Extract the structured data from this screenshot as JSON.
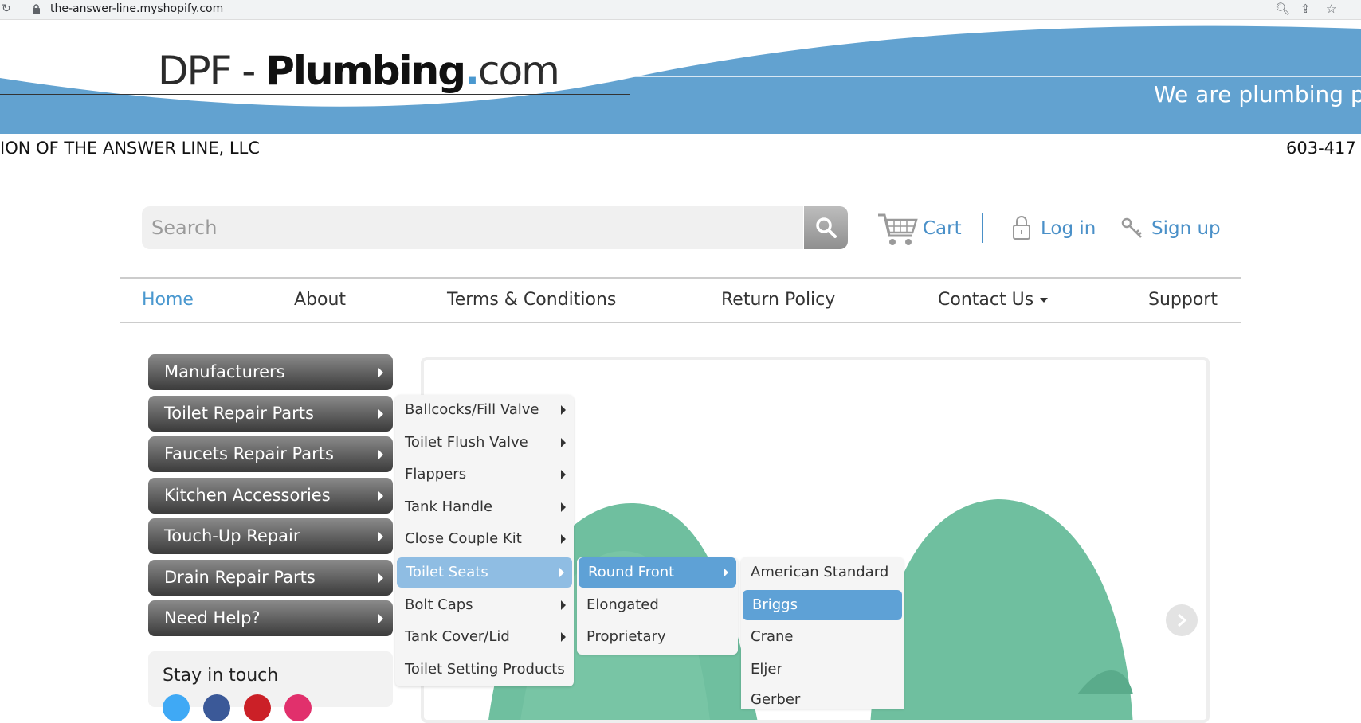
{
  "browser": {
    "url": "the-answer-line.myshopify.com"
  },
  "header": {
    "logo_dpf": "DPF - ",
    "logo_plumbing": "Plumbing",
    "logo_dot": ".",
    "logo_com": "com",
    "banner": "We are plumbing p",
    "subline_left": "ION OF THE ANSWER LINE, LLC",
    "subline_right": "603-417"
  },
  "search": {
    "placeholder": "Search"
  },
  "account": {
    "cart": "Cart",
    "login": "Log in",
    "signup": "Sign up"
  },
  "nav": {
    "items": [
      "Home",
      "About",
      "Terms & Conditions",
      "Return Policy",
      "Contact Us",
      "Support"
    ]
  },
  "sidebar": {
    "items": [
      "Manufacturers",
      "Toilet Repair Parts",
      "Faucets Repair Parts",
      "Kitchen Accessories",
      "Touch-Up Repair",
      "Drain Repair Parts",
      "Need Help?"
    ],
    "stay_in_touch": "Stay in touch"
  },
  "menu1": {
    "items": [
      "Ballcocks/Fill Valve",
      "Toilet Flush Valve",
      "Flappers",
      "Tank Handle",
      "Close Couple Kit",
      "Toilet Seats",
      "Bolt Caps",
      "Tank Cover/Lid",
      "Toilet Setting Products"
    ]
  },
  "menu2": {
    "items": [
      "Round Front",
      "Elongated",
      "Proprietary"
    ]
  },
  "menu3": {
    "items": [
      "American Standard",
      "Briggs",
      "Crane",
      "Eljer",
      "Gerber"
    ]
  },
  "colors": {
    "accent": "#4a98cf",
    "banner": "#62a2d0",
    "toilet": "#6fbf9f"
  }
}
